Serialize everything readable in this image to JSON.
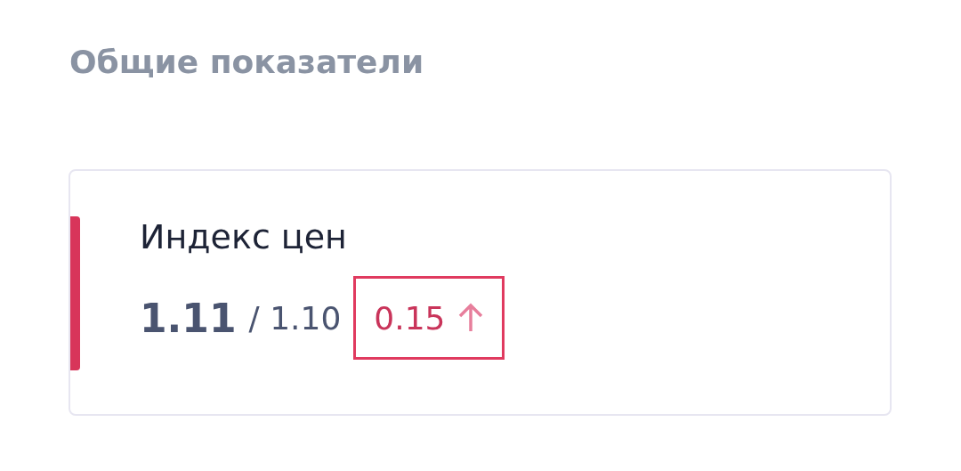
{
  "section_title": "Общие показатели",
  "metric": {
    "label": "Индекс цен",
    "value": "1.11",
    "previous": "/ 1.10",
    "change": "0.15",
    "rising": true,
    "highlighted": true
  }
}
